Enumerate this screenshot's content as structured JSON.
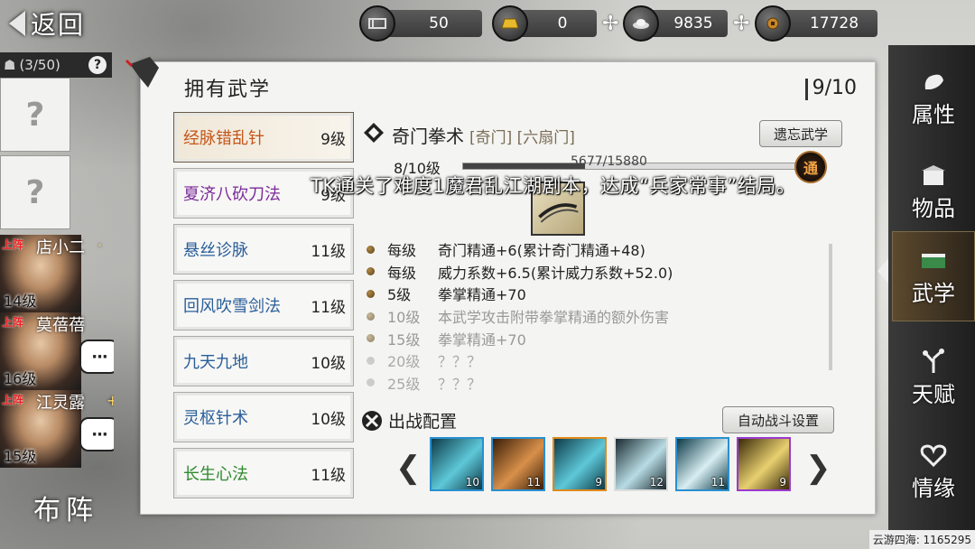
{
  "top": {
    "back_label": "返回",
    "resources": [
      {
        "icon": "scroll-icon",
        "value": "50",
        "has_plus": false
      },
      {
        "icon": "gold-bar-icon",
        "value": "0",
        "has_plus": true
      },
      {
        "icon": "silver-ingot-icon",
        "value": "9835",
        "has_plus": true
      },
      {
        "icon": "coin-icon",
        "value": "17728",
        "has_plus": true
      }
    ]
  },
  "party": {
    "count": "(3/50)",
    "help": "?",
    "empty_slot": "?",
    "heroes": [
      {
        "tag": "上阵",
        "name": "店小二",
        "level": "14级",
        "bubble": "···",
        "extra": "·"
      },
      {
        "tag": "上阵",
        "name": "莫蓓蓓",
        "level": "16级",
        "bubble": "···",
        "extra": ""
      },
      {
        "tag": "上阵",
        "name": "江灵露",
        "level": "15级",
        "bubble": "···",
        "extra": "+1"
      }
    ],
    "formation_label": "布阵"
  },
  "panel": {
    "title": "拥有武学",
    "count": "9/10",
    "skills": [
      {
        "name": "经脉错乱针",
        "level": "9级",
        "color": "#c4561a",
        "selected": true
      },
      {
        "name": "夏济八砍刀法",
        "level": "9级",
        "color": "#7b2a9a",
        "selected": false
      },
      {
        "name": "悬丝诊脉",
        "level": "11级",
        "color": "#2a5e9a",
        "selected": false
      },
      {
        "name": "回风吹雪剑法",
        "level": "11级",
        "color": "#2a5e9a",
        "selected": false
      },
      {
        "name": "九天九地",
        "level": "10级",
        "color": "#2a5e9a",
        "selected": false
      },
      {
        "name": "灵枢针术",
        "level": "10级",
        "color": "#2a5e9a",
        "selected": false
      },
      {
        "name": "长生心法",
        "level": "11级",
        "color": "#2f8a2f",
        "selected": false
      }
    ]
  },
  "detail": {
    "name": "奇门拳术",
    "tags": "[奇门] [六扇门]",
    "forget_label": "遗忘武学",
    "level": "8/10级",
    "progress_text": "5677/15880",
    "progress_fraction": 0.357,
    "tong_label": "通",
    "notice": "TK通关了难度1魔君乱江湖剧本，达成“兵家常事”结局。",
    "effects": [
      {
        "lvl": "每级",
        "text": "奇门精通+6(累计奇门精通+48)",
        "state": "active"
      },
      {
        "lvl": "每级",
        "text": "威力系数+6.5(累计威力系数+52.0)",
        "state": "active"
      },
      {
        "lvl": "5级",
        "text": "拳掌精通+70",
        "state": "active"
      },
      {
        "lvl": "10级",
        "text": "本武学攻击附带拳掌精通的额外伤害",
        "state": "dim"
      },
      {
        "lvl": "15级",
        "text": "拳掌精通+70",
        "state": "dim"
      },
      {
        "lvl": "20级",
        "text": "？？？",
        "state": "locked"
      },
      {
        "lvl": "25级",
        "text": "？？？",
        "state": "locked"
      }
    ]
  },
  "battle": {
    "title": "出战配置",
    "auto_label": "自动战斗设置",
    "slots": [
      {
        "num": "10",
        "border": "#2a8fd0",
        "colors": [
          "#0d3a48",
          "#5ec8d8"
        ]
      },
      {
        "num": "11",
        "border": "#2a8fd0",
        "colors": [
          "#3a1e08",
          "#d8904a"
        ]
      },
      {
        "num": "9",
        "border": "#e08a1a",
        "colors": [
          "#0d3a48",
          "#5ec8d8"
        ]
      },
      {
        "num": "12",
        "border": "#dddddd",
        "colors": [
          "#1a2a30",
          "#b8dce4"
        ]
      },
      {
        "num": "11",
        "border": "#2a8fd0",
        "colors": [
          "#0d3a48",
          "#d8eef2"
        ]
      },
      {
        "num": "9",
        "border": "#9a3ad0",
        "colors": [
          "#3a2a08",
          "#e8d070"
        ]
      }
    ]
  },
  "tabs": [
    {
      "label": "属性",
      "icon": "rooster-icon",
      "active": false
    },
    {
      "label": "物品",
      "icon": "box-icon",
      "active": false
    },
    {
      "label": "武学",
      "icon": "book-icon",
      "active": true
    },
    {
      "label": "天赋",
      "icon": "branch-icon",
      "active": false
    },
    {
      "label": "情缘",
      "icon": "heart-icon",
      "active": false
    }
  ],
  "footer": "云游四海: 1165295"
}
